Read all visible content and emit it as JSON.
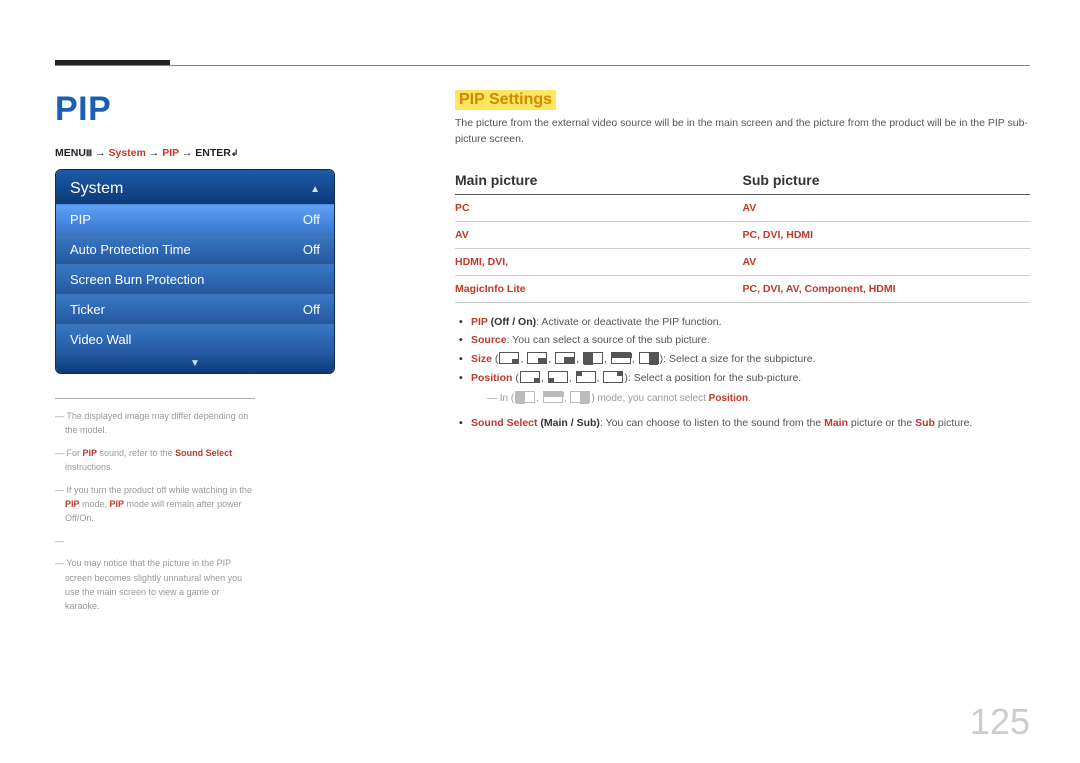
{
  "page_number": "125",
  "h1": "PIP",
  "breadcrumb": {
    "menu": "MENU",
    "icon1": "Ⅲ",
    "arrow": "→",
    "system": "System",
    "pip": "PIP",
    "enter": "ENTER",
    "icon2": "↲"
  },
  "osd": {
    "title": "System",
    "rows": [
      {
        "label": "PIP",
        "value": "Off",
        "selected": true
      },
      {
        "label": "Auto Protection Time",
        "value": "Off",
        "selected": false
      },
      {
        "label": "Screen Burn Protection",
        "value": "",
        "selected": false
      },
      {
        "label": "Ticker",
        "value": "Off",
        "selected": false
      },
      {
        "label": "Video Wall",
        "value": "",
        "selected": false
      }
    ]
  },
  "footnotes": {
    "f1_pre": "― The displayed image may differ depending on the model.",
    "f2_a": "― For ",
    "f2_b": "PIP",
    "f2_c": " sound, refer to the ",
    "f2_d": "Sound Select",
    "f2_e": " instructions.",
    "f3_a": "― If you turn the product off while watching in the ",
    "f3_b": "PIP",
    "f3_c": " mode, ",
    "f3_d": "PIP",
    "f3_e": " mode will remain after power Off/On.",
    "f4": "―",
    "f5": "― You may notice that the picture in the PIP screen becomes slightly unnatural when you use the main screen to view a game or karaoke."
  },
  "h2": "PIP Settings",
  "intro": "The picture from the external video source will be in the main screen and the picture from the product will be in the PIP sub-picture screen.",
  "table": {
    "col1": "Main picture",
    "col2": "Sub picture",
    "rows": [
      {
        "main": "PC",
        "sub": "AV"
      },
      {
        "main": "AV",
        "sub": "PC, DVI, HDMI"
      },
      {
        "main": "HDMI, DVI,",
        "sub": "AV"
      },
      {
        "main": "MagicInfo Lite",
        "sub": "PC, DVI, AV, Component, HDMI"
      }
    ]
  },
  "bullets": {
    "b1": {
      "hl": "PIP",
      "paren": " (Off / On)",
      "text": ": Activate or deactivate the PIP function."
    },
    "b2": {
      "hl": "Source",
      "text": ": You can select a source of the sub picture."
    },
    "b3": {
      "hl": "Size",
      "text": ": Select a size for the subpicture."
    },
    "b4": {
      "hl": "Position",
      "text": ": Select a position for the sub-picture."
    },
    "b4_note_a": "― In",
    "b4_note_b": " mode, you cannot select ",
    "b4_note_c": "Position",
    "b4_note_d": ".",
    "b5_a": "Sound Select",
    "b5_b": " (Main / Sub)",
    "b5_c": ": You can choose to listen to the sound from the ",
    "b5_d": "Main",
    "b5_e": " picture or the ",
    "b5_f": "Sub",
    "b5_g": " picture."
  }
}
